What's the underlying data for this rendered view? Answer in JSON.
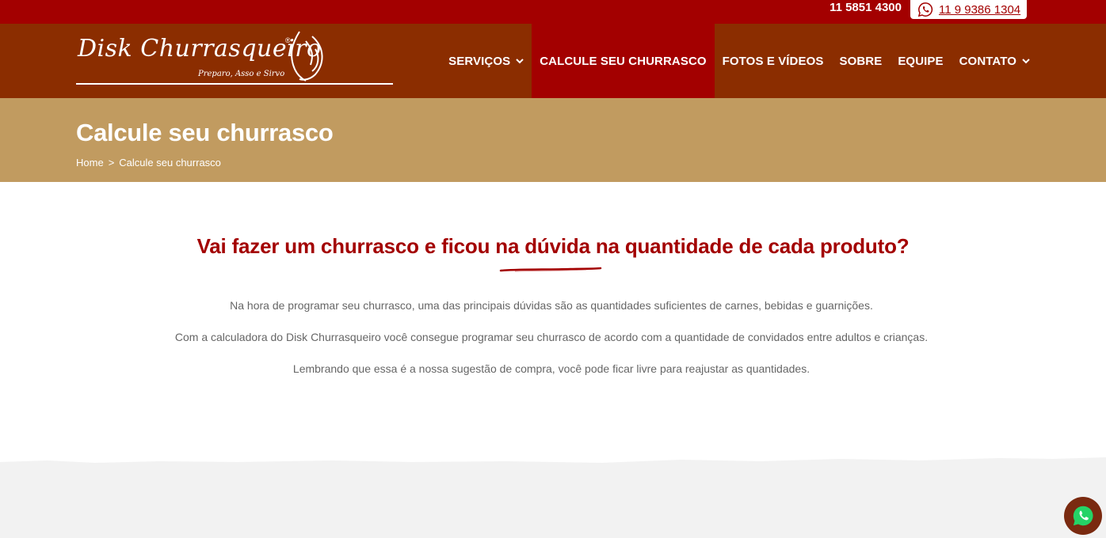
{
  "topbar": {
    "phone": "11 5851 4300",
    "whatsapp": "11 9 9386 1304"
  },
  "logo": {
    "name": "Disk Churrasqueiro",
    "registered": "®",
    "tagline": "Preparo, Asso e Sirvo"
  },
  "nav": {
    "items": [
      {
        "label": "SERVIÇOS",
        "has_dropdown": true
      },
      {
        "label": "CALCULE SEU CHURRASCO",
        "active": true
      },
      {
        "label": "FOTOS E VÍDEOS"
      },
      {
        "label": "SOBRE"
      },
      {
        "label": "EQUIPE"
      },
      {
        "label": "CONTATO",
        "has_dropdown": true
      }
    ]
  },
  "banner": {
    "title": "Calcule seu churrasco",
    "breadcrumb": [
      "Home",
      ">",
      "Calcule seu churrasco"
    ]
  },
  "content": {
    "headline": "Vai fazer um churrasco e ficou na dúvida na quantidade de cada produto?",
    "paragraphs": [
      "Na hora de programar seu churrasco, uma das principais dúvidas são as quantidades suficientes de carnes, bebidas e guarnições.",
      "Com a calculadora do Disk Churrasqueiro você consegue programar seu churrasco de acordo com a quantidade de convidados entre adultos e crianças.",
      "Lembrando que essa é a nossa sugestão de compra, você pode ficar livre para reajustar as quantidades."
    ]
  },
  "icons": {
    "whatsapp": "whatsapp-icon",
    "chevron": "chevron-down-icon",
    "flame": "flame-icon"
  },
  "colors": {
    "top_bar": "#a30000",
    "header": "#8b2d00",
    "nav_active": "#a30000",
    "banner": "#c19b60",
    "headline": "#a30000",
    "body_text": "#666666",
    "bottom_band": "#f2f2f2"
  }
}
